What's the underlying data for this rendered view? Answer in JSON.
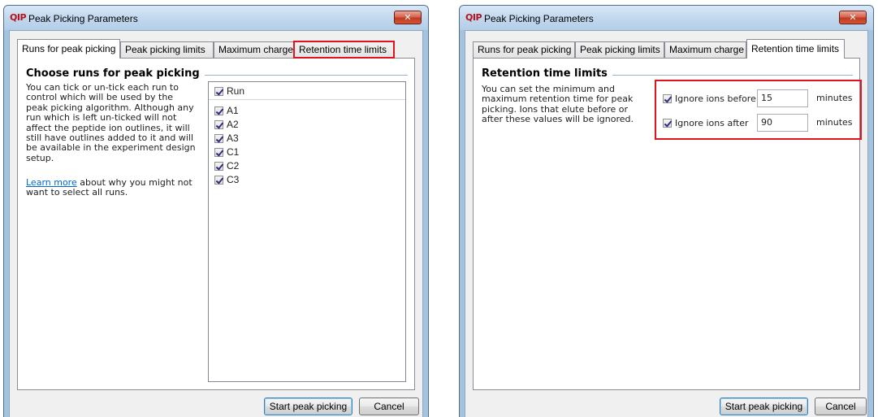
{
  "window_title": "Peak Picking Parameters",
  "app_logo": "QIP",
  "close_glyph": "✕",
  "tabs": [
    "Runs for peak picking",
    "Peak picking limits",
    "Maximum charge",
    "Retention time limits"
  ],
  "runs_panel": {
    "heading": "Choose runs for peak picking",
    "description": [
      "You can tick or un-tick each run to",
      "control which will be used by the",
      "peak picking algorithm. Although any",
      "run which is left un-ticked will not",
      "affect the peptide ion outlines, it will",
      "still have outlines added to it and will",
      "be available in the experiment design",
      "setup."
    ],
    "learn_more_link": "Learn more",
    "learn_more_rest": " about why you might not want to select all runs.",
    "column_header": "Run",
    "runs": [
      {
        "name": "A1",
        "checked": true
      },
      {
        "name": "A2",
        "checked": true
      },
      {
        "name": "A3",
        "checked": true
      },
      {
        "name": "C1",
        "checked": true
      },
      {
        "name": "C2",
        "checked": true
      },
      {
        "name": "C3",
        "checked": true
      }
    ]
  },
  "retention_panel": {
    "heading": "Retention time limits",
    "description": [
      "You can set the minimum and",
      "maximum retention time for peak",
      "picking. Ions that elute before or",
      "after these values will be ignored."
    ],
    "ignore_before": {
      "label": "Ignore ions before",
      "value": "15",
      "unit": "minutes",
      "checked": true
    },
    "ignore_after": {
      "label": "Ignore ions after",
      "value": "90",
      "unit": "minutes",
      "checked": true
    }
  },
  "buttons": {
    "start": "Start peak picking",
    "cancel": "Cancel"
  },
  "colors": {
    "highlight": "#e0141e",
    "link": "#0066cc",
    "logo": "#b5121b"
  }
}
